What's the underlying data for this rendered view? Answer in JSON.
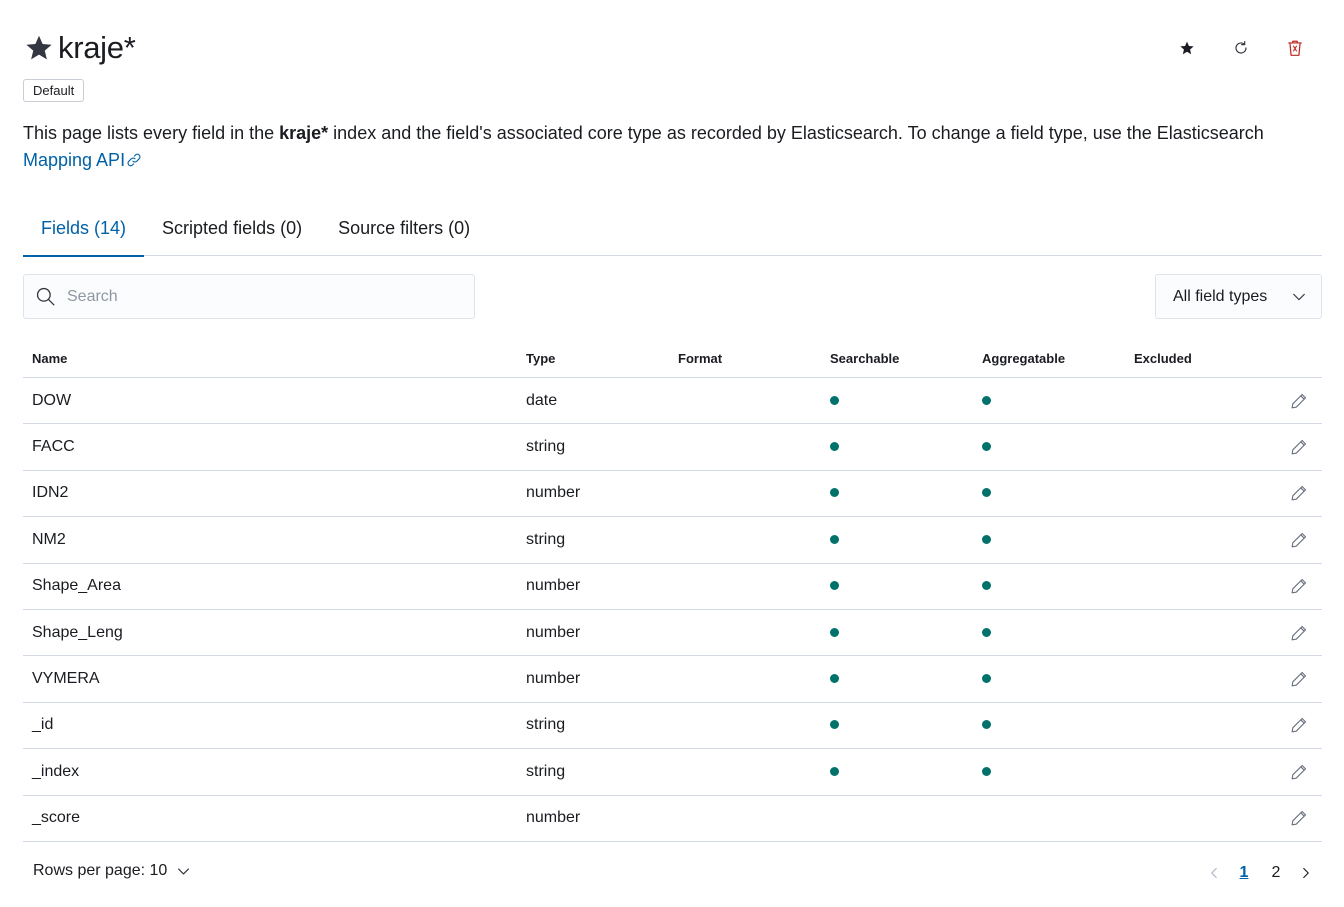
{
  "header": {
    "title": "kraje*",
    "badge": "Default",
    "icons": [
      "star-icon",
      "refresh-icon",
      "trash-icon"
    ],
    "delete_color": "#bd271e"
  },
  "description": {
    "before": "This page lists every field in the ",
    "index": "kraje*",
    "after": " index and the field's associated core type as recorded by Elasticsearch. To change a field type, use the Elasticsearch ",
    "link": "Mapping API"
  },
  "tabs": [
    {
      "label": "Fields (14)",
      "active": true
    },
    {
      "label": "Scripted fields (0)",
      "active": false
    },
    {
      "label": "Source filters (0)",
      "active": false
    }
  ],
  "search": {
    "placeholder": "Search",
    "value": ""
  },
  "filter": {
    "label": "All field types"
  },
  "table": {
    "columns": [
      "Name",
      "Type",
      "Format",
      "Searchable",
      "Aggregatable",
      "Excluded"
    ],
    "rows": [
      {
        "name": "DOW",
        "type": "date",
        "format": "",
        "searchable": true,
        "aggregatable": true
      },
      {
        "name": "FACC",
        "type": "string",
        "format": "",
        "searchable": true,
        "aggregatable": true
      },
      {
        "name": "IDN2",
        "type": "number",
        "format": "",
        "searchable": true,
        "aggregatable": true
      },
      {
        "name": "NM2",
        "type": "string",
        "format": "",
        "searchable": true,
        "aggregatable": true
      },
      {
        "name": "Shape_Area",
        "type": "number",
        "format": "",
        "searchable": true,
        "aggregatable": true
      },
      {
        "name": "Shape_Leng",
        "type": "number",
        "format": "",
        "searchable": true,
        "aggregatable": true
      },
      {
        "name": "VYMERA",
        "type": "number",
        "format": "",
        "searchable": true,
        "aggregatable": true
      },
      {
        "name": "_id",
        "type": "string",
        "format": "",
        "searchable": true,
        "aggregatable": true
      },
      {
        "name": "_index",
        "type": "string",
        "format": "",
        "searchable": true,
        "aggregatable": true
      },
      {
        "name": "_score",
        "type": "number",
        "format": "",
        "searchable": false,
        "aggregatable": false
      }
    ]
  },
  "pagination": {
    "rows_per_page": "Rows per page: 10",
    "pages": [
      "1",
      "2"
    ],
    "current": "1"
  },
  "colors": {
    "accent": "#0061a6",
    "dot": "#00726b",
    "border": "#d3dae6"
  }
}
